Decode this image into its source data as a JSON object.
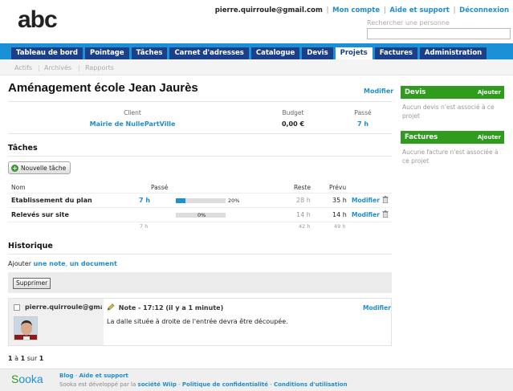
{
  "header": {
    "logo": "abc",
    "user_email": "pierre.quirroule@gmail.com",
    "links": [
      "Mon compte",
      "Aide et support",
      "Déconnexion"
    ],
    "search_placeholder": "Rechercher une personne"
  },
  "nav": {
    "tabs": [
      "Tableau de bord",
      "Pointage",
      "Tâches",
      "Carnet d'adresses",
      "Catalogue",
      "Devis",
      "Projets",
      "Factures",
      "Administration"
    ],
    "active_tab": "Projets",
    "subnav": [
      "Actifs",
      "Archivés",
      "Rapports"
    ]
  },
  "project": {
    "title": "Aménagement école Jean Jaurès",
    "modify_label": "Modifier",
    "headers": {
      "client": "Client",
      "budget": "Budget",
      "passe": "Passé"
    },
    "client": "Mairie de NullePartVille",
    "budget": "0,00 €",
    "passe": "7 h"
  },
  "tasks": {
    "title": "Tâches",
    "new_button": "Nouvelle tâche",
    "headers": {
      "name": "Nom",
      "passe": "Passé",
      "reste": "Reste",
      "prevu": "Prévu"
    },
    "rows": [
      {
        "name": "Etablissement du plan",
        "passe": "7 h",
        "progress_pct": "20%",
        "progress": 0.2,
        "reste": "28 h",
        "prevu": "35 h",
        "action": "Modifier"
      },
      {
        "name": "Relevés sur site",
        "passe": "",
        "progress_pct": "0%",
        "progress": 0,
        "reste": "14 h",
        "prevu": "14 h",
        "action": "Modifier"
      }
    ],
    "totals": {
      "passe": "7 h",
      "reste": "42 h",
      "prevu": "49 h"
    }
  },
  "history": {
    "title": "Historique",
    "add_prefix": "Ajouter",
    "add_note": "une note",
    "add_sep": ",",
    "add_doc": "un document",
    "delete_button": "Supprimer",
    "entry": {
      "user": "pierre.quirroule@gmail.com",
      "heading": "Note - 17:12",
      "relative": "(il y a 1 minute)",
      "modify": "Modifier",
      "text": "La dalle située à droite de l'entrée devra être découpée."
    },
    "pager": {
      "from": "1",
      "a": "à",
      "to": "1",
      "sur": "sur",
      "total": "1"
    }
  },
  "sidebar": {
    "devis": {
      "title": "Devis",
      "add": "Ajouter",
      "empty": "Aucun devis n'est associé à ce projet"
    },
    "factures": {
      "title": "Factures",
      "add": "Ajouter",
      "empty": "Aucune facture n'est associée à ce projet"
    }
  },
  "footer": {
    "logo_s": "S",
    "logo_rest": "ooka",
    "line1_links": [
      "Blog",
      "Aide et support"
    ],
    "line2_prefix": "Sooka est développé par la",
    "line2_links": [
      "société Wiip",
      "Politique de confidentialité",
      "Conditions d'utilisation"
    ]
  },
  "colors": {
    "nav_bar": "#1a90d6",
    "tab": "#1c3f8a",
    "link": "#1f8dcc",
    "panel": "#2f9c1d"
  }
}
